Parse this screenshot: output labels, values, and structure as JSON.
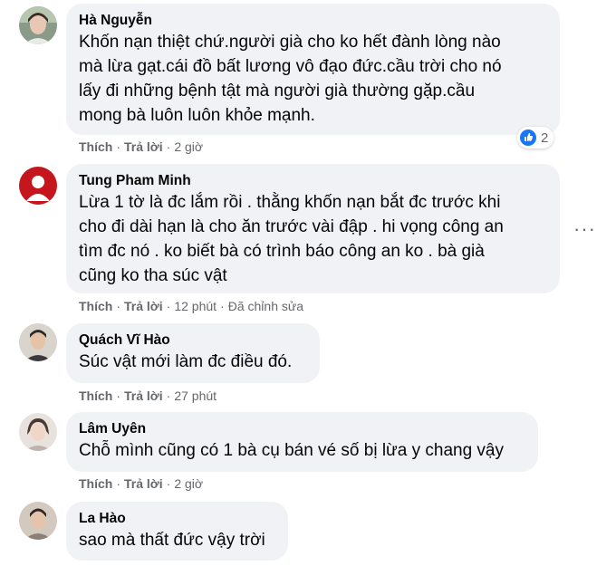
{
  "comments": [
    {
      "name": "Hà Nguyễn",
      "lines": [
        "Khốn nạn thiệt chứ.người già cho ko hết đành lòng nào",
        "mà lừa gạt.cái đồ bất lương vô đạo đức.cầu trời cho nó",
        "lấy đi những bệnh tật mà người già thường gặp.cầu",
        "mong bà luôn luôn khỏe mạnh."
      ],
      "like": "Thích",
      "reply": "Trả lời",
      "time": "2 giờ",
      "reaction_count": "2"
    },
    {
      "name": "Tung Pham Minh",
      "lines": [
        "Lừa 1 tờ là đc lắm rồi . thằng khốn nạn bắt đc trước khi",
        "cho đi dài hạn là cho ăn trước vài đập . hi vọng công an",
        "tìm đc nó . ko biết bà có trình báo công an ko . bà già",
        "cũng ko tha súc vật"
      ],
      "like": "Thích",
      "reply": "Trả lời",
      "time": "12 phút",
      "edited": "Đã chỉnh sửa"
    },
    {
      "name": "Quách Vĩ Hào",
      "lines": [
        "Súc vật mới làm đc điều đó."
      ],
      "like": "Thích",
      "reply": "Trả lời",
      "time": "27 phút"
    },
    {
      "name": "Lâm Uyên",
      "lines": [
        "Chỗ mình cũng có 1 bà cụ bán vé số bị lừa y chang vậy"
      ],
      "like": "Thích",
      "reply": "Trả lời",
      "time": "2 giờ"
    },
    {
      "name": "La Hào",
      "lines": [
        "sao mà thất đức vậy trời"
      ]
    }
  ],
  "colors": {
    "bubble": "#f0f2f5",
    "meta": "#65676b",
    "like_blue": "#1877f2"
  }
}
